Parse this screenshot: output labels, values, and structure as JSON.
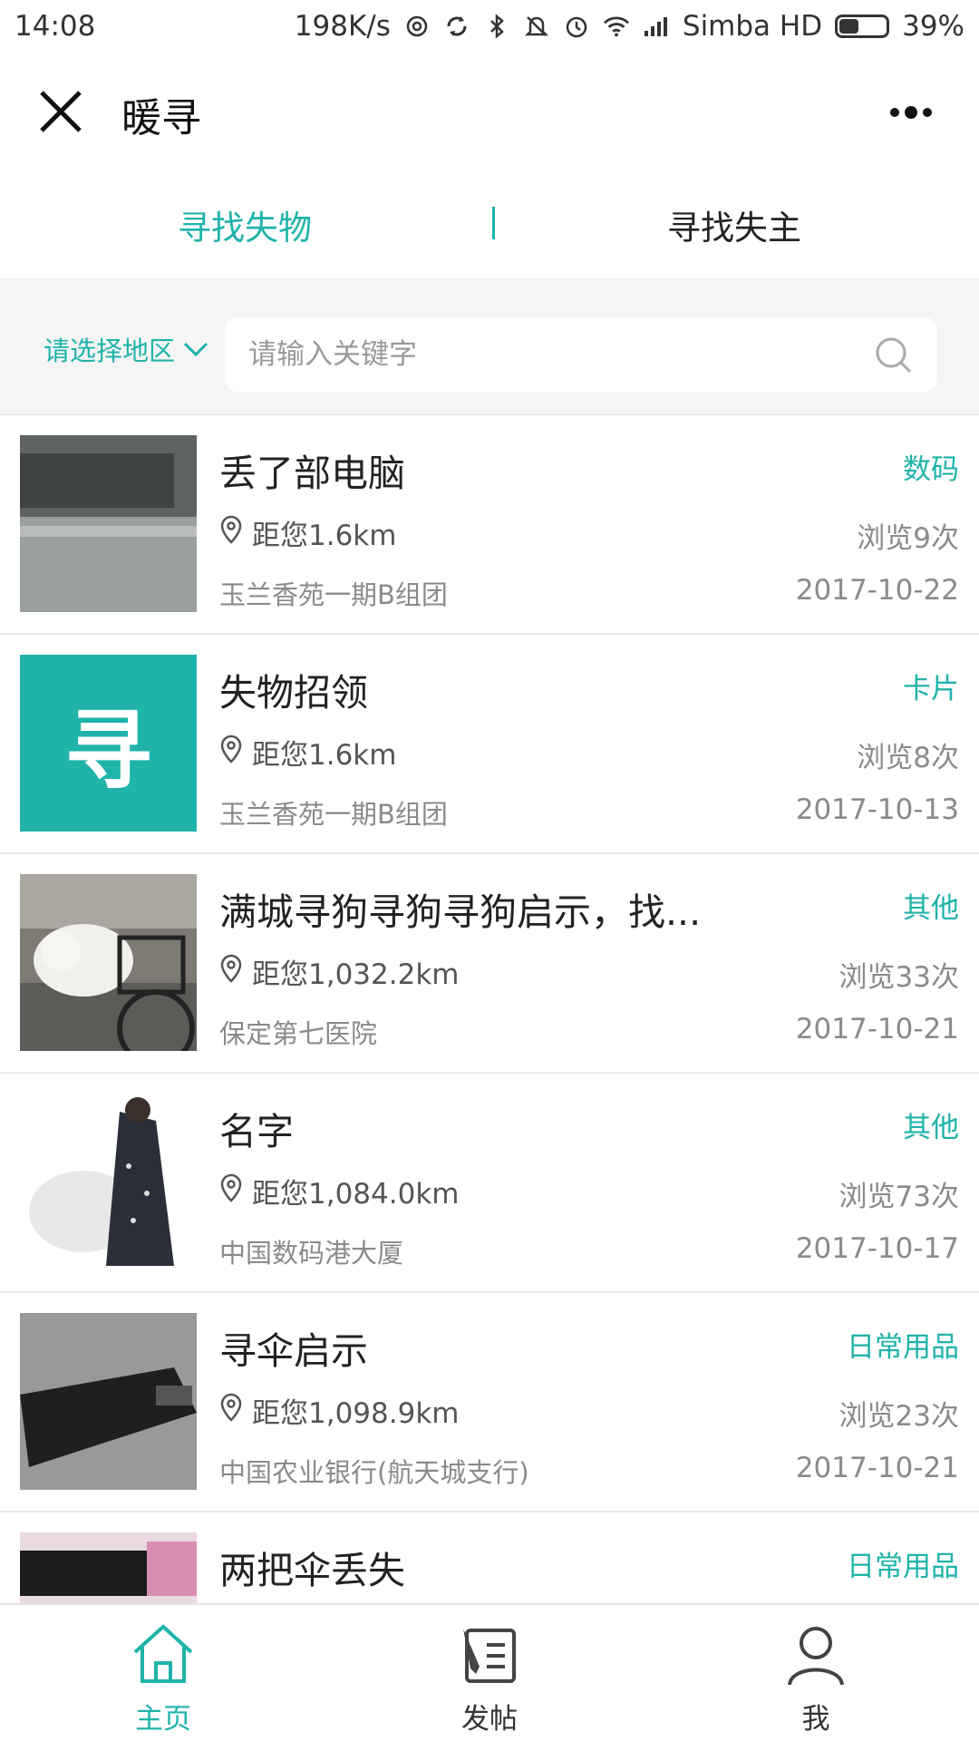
{
  "status_bar": {
    "time": "14:08",
    "speed": "198K/s",
    "carrier": "Simba HD",
    "battery_text": "39%",
    "battery_level": 0.39,
    "icons": [
      "hotspot-icon",
      "sync-icon",
      "bluetooth-icon",
      "mute-icon",
      "alarm-icon",
      "wifi-icon",
      "signal-icon"
    ]
  },
  "nav": {
    "title": "暖寻",
    "close_icon": "close-icon",
    "more_icon": "more-icon"
  },
  "tabs": [
    {
      "label": "寻找失物",
      "active": true
    },
    {
      "label": "寻找失主",
      "active": false
    }
  ],
  "search": {
    "region_label": "请选择地区",
    "placeholder": "请输入关键字",
    "value": ""
  },
  "items": [
    {
      "title": "丢了部电脑",
      "category": "数码",
      "distance": "距您1.6km",
      "views": "浏览9次",
      "location": "玉兰香苑一期B组团",
      "date": "2017-10-22",
      "thumb": "laptop-photo"
    },
    {
      "title": "失物招领",
      "category": "卡片",
      "distance": "距您1.6km",
      "views": "浏览8次",
      "location": "玉兰香苑一期B组团",
      "date": "2017-10-13",
      "thumb": "xun-logo",
      "thumb_text": "寻"
    },
    {
      "title": "满城寻狗寻狗寻狗启示，找...",
      "category": "其他",
      "distance": "距您1,032.2km",
      "views": "浏览33次",
      "location": "保定第七医院",
      "date": "2017-10-21",
      "thumb": "dog-photo"
    },
    {
      "title": "名字",
      "category": "其他",
      "distance": "距您1,084.0km",
      "views": "浏览73次",
      "location": "中国数码港大厦",
      "date": "2017-10-17",
      "thumb": "scooter-photo"
    },
    {
      "title": "寻伞启示",
      "category": "日常用品",
      "distance": "距您1,098.9km",
      "views": "浏览23次",
      "location": "中国农业银行(航天城支行)",
      "date": "2017-10-21",
      "thumb": "umbrella-photo"
    },
    {
      "title": "两把伞丢失",
      "category": "日常用品",
      "distance": "",
      "views": "",
      "location": "",
      "date": "",
      "thumb": "umbrellas-photo"
    }
  ],
  "bottom_nav": [
    {
      "label": "主页",
      "icon": "home-icon",
      "active": true
    },
    {
      "label": "发帖",
      "icon": "post-icon",
      "active": false
    },
    {
      "label": "我",
      "icon": "user-icon",
      "active": false
    }
  ],
  "colors": {
    "accent": "#1fb3a9",
    "text": "#222222",
    "muted": "#8a8a8a",
    "search_bg": "#f5f5f5"
  }
}
